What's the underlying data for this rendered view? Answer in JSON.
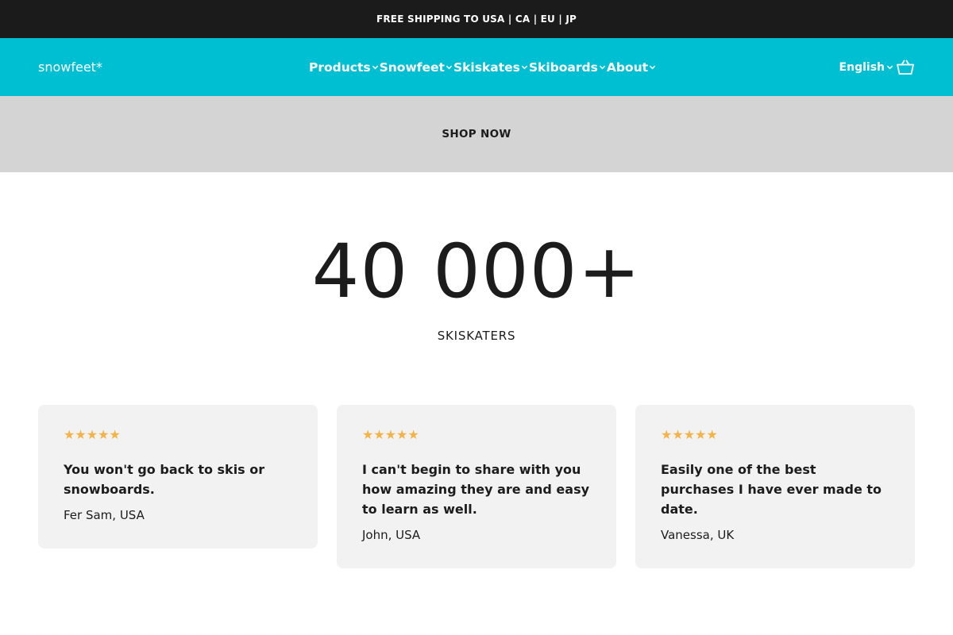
{
  "announcement": {
    "text": "FREE SHIPPING TO USA | CA | EU | JP"
  },
  "header": {
    "logo": "snowfeet*",
    "nav": [
      {
        "label": "Products"
      },
      {
        "label": "Snowfeet"
      },
      {
        "label": "Skiskates"
      },
      {
        "label": "Skiboards"
      },
      {
        "label": "About"
      }
    ],
    "language": "English",
    "icons": {
      "dropdown": "chevron-down-icon",
      "cart": "cart-icon"
    }
  },
  "hero": {
    "cta": "SHOP NOW"
  },
  "stat": {
    "number": "40 000+",
    "label": "SKISKATERS"
  },
  "reviews": [
    {
      "rating": 5,
      "stars": "★★★★★",
      "quote": "You won't go back to skis or snowboards.",
      "author": "Fer Sam, USA"
    },
    {
      "rating": 5,
      "stars": "★★★★★",
      "quote": "I can't begin to share with you how amazing they are and easy to learn as well.",
      "author": "John, USA"
    },
    {
      "rating": 5,
      "stars": "★★★★★",
      "quote": "Easily one of the best purchases I have ever made to date.",
      "author": "Vanessa, UK"
    }
  ],
  "colors": {
    "header_bg": "#00bfd3",
    "announcement_bg": "#1c1b1b",
    "band_bg": "#d4d4d4",
    "card_bg": "#f2f2f2",
    "star": "#f5b346"
  }
}
